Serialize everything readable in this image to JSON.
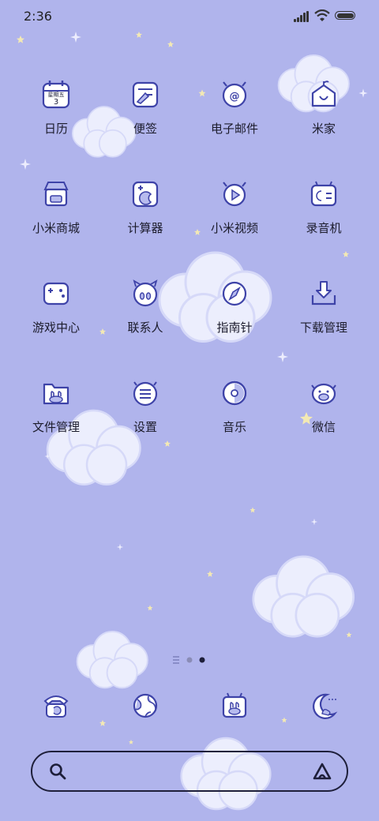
{
  "status_bar": {
    "time": "2:36"
  },
  "grid": [
    {
      "label": "日历",
      "icon": "calendar-icon",
      "calendar_weekday": "星期五",
      "calendar_day": "3"
    },
    {
      "label": "便签",
      "icon": "notes-icon"
    },
    {
      "label": "电子邮件",
      "icon": "email-icon"
    },
    {
      "label": "米家",
      "icon": "mijia-home-icon"
    },
    {
      "label": "小米商城",
      "icon": "mi-store-icon"
    },
    {
      "label": "计算器",
      "icon": "calculator-icon"
    },
    {
      "label": "小米视频",
      "icon": "video-icon"
    },
    {
      "label": "录音机",
      "icon": "recorder-icon"
    },
    {
      "label": "游戏中心",
      "icon": "game-center-icon"
    },
    {
      "label": "联系人",
      "icon": "contacts-icon"
    },
    {
      "label": "指南针",
      "icon": "compass-icon"
    },
    {
      "label": "下载管理",
      "icon": "download-manager-icon"
    },
    {
      "label": "文件管理",
      "icon": "file-manager-icon"
    },
    {
      "label": "设置",
      "icon": "settings-icon"
    },
    {
      "label": "音乐",
      "icon": "music-icon"
    },
    {
      "label": "微信",
      "icon": "wechat-icon"
    }
  ],
  "page_indicator": {
    "pages": 2,
    "current": 2
  },
  "dock": [
    {
      "icon": "phone-icon"
    },
    {
      "icon": "browser-icon"
    },
    {
      "icon": "camera-icon"
    },
    {
      "icon": "moon-theme-icon"
    }
  ],
  "search_bar": {
    "placeholder": ""
  },
  "colors": {
    "wallpaper": "#b0b4ec",
    "icon_line": "#3e43a8",
    "cloud": "#eceefd"
  }
}
